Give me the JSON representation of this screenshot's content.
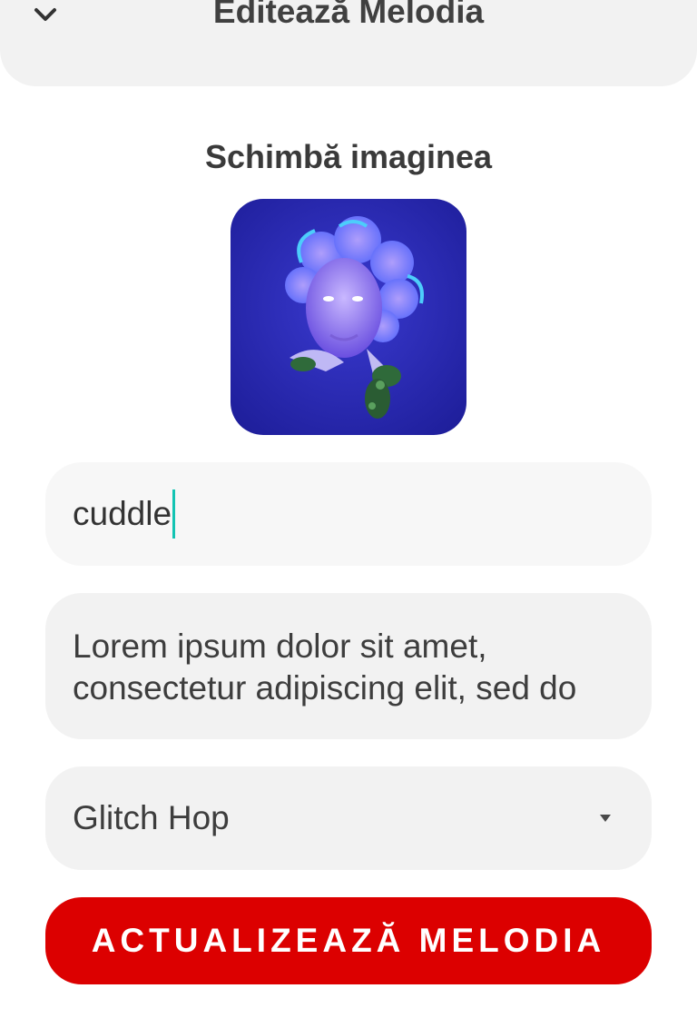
{
  "header": {
    "title": "Editează Melodia",
    "back_icon": "chevron-down-icon"
  },
  "image_section": {
    "title": "Schimbă imaginea"
  },
  "form": {
    "title_value": "cuddle",
    "description_value": "Lorem ipsum dolor sit amet, consectetur adipiscing elit, sed do",
    "genre_value": "Glitch Hop",
    "genre_icon": "caret-down-icon",
    "submit_label": "ACTUALIZEAZĂ MELODIA"
  },
  "colors": {
    "accent": "#dc0000",
    "caret": "#13c4b3",
    "field_background": "#f2f2f2"
  }
}
